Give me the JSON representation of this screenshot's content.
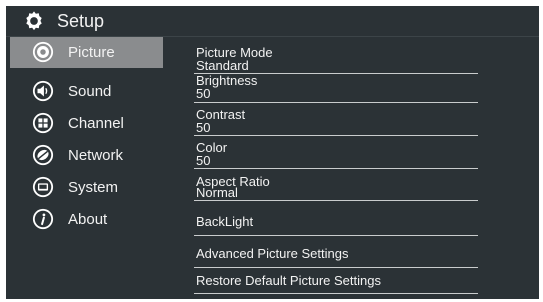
{
  "header": {
    "title": "Setup",
    "icon": "gear-icon"
  },
  "sidebar": {
    "items": [
      {
        "label": "Picture",
        "icon": "picture-icon",
        "active": true
      },
      {
        "label": "Sound",
        "icon": "speaker-icon",
        "active": false
      },
      {
        "label": "Channel",
        "icon": "channel-grid-icon",
        "active": false
      },
      {
        "label": "Network",
        "icon": "network-icon",
        "active": false
      },
      {
        "label": "System",
        "icon": "system-icon",
        "active": false
      },
      {
        "label": "About",
        "icon": "info-icon",
        "active": false
      }
    ]
  },
  "settings": {
    "picture_mode": {
      "label": "Picture Mode",
      "value": "Standard"
    },
    "brightness": {
      "label": "Brightness",
      "value": "50"
    },
    "contrast": {
      "label": "Contrast",
      "value": "50"
    },
    "color": {
      "label": "Color",
      "value": "50"
    },
    "aspect_ratio": {
      "label": "Aspect Ratio",
      "value": "Normal"
    },
    "backlight": {
      "label": "BackLight"
    },
    "advanced": {
      "label": "Advanced Picture Settings"
    },
    "restore": {
      "label": "Restore Default Picture Settings"
    }
  },
  "colors": {
    "background": "#1e2326",
    "panel": "#2b3236",
    "active_item": "#8a8c8e",
    "text": "#f2f2f2",
    "separator": "#c9cccd"
  }
}
